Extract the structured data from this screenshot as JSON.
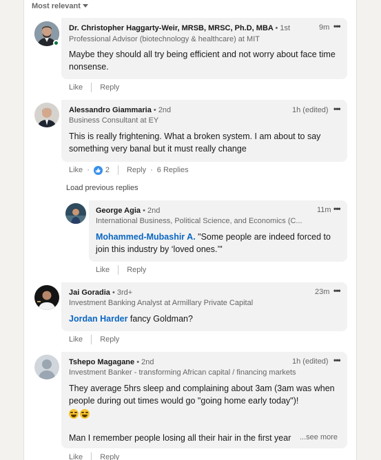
{
  "sort": {
    "label": "Most relevant"
  },
  "comments": [
    {
      "name": "Dr. Christopher Haggarty-Weir, MRSB, MRSC, Ph.D, MBA",
      "degree": "• 1st",
      "headline": "Professional Advisor (biotechnology & healthcare) at MIT",
      "time": "9m",
      "text": "Maybe they should all try being efficient and not worry about face time nonsense.",
      "actions": {
        "like": "Like",
        "reply": "Reply"
      }
    },
    {
      "name": "Alessandro Giammaria",
      "degree": "• 2nd",
      "headline": "Business Consultant at EY",
      "time": "1h (edited)",
      "text": "This is really frightening. What a broken system. I am about to say something very banal but it must really change",
      "actions": {
        "like": "Like",
        "reaction_count": "2",
        "reply": "Reply",
        "replies": "6 Replies"
      },
      "load_previous": "Load previous replies",
      "reply": {
        "name": "George Agia",
        "degree": "• 2nd",
        "headline": "International Business, Political Science, and Economics (C...",
        "time": "11m",
        "mention": "Mohammed-Mubashir A.",
        "text": " \"Some people are indeed forced to join this industry by ‘loved ones.’\"",
        "actions": {
          "like": "Like",
          "reply": "Reply"
        }
      }
    },
    {
      "name": "Jai Goradia",
      "degree": "• 3rd+",
      "headline": "Investment Banking Analyst at Armillary Private Capital",
      "time": "23m",
      "mention": "Jordan Harder",
      "text": " fancy Goldman?",
      "actions": {
        "like": "Like",
        "reply": "Reply"
      }
    },
    {
      "name": "Tshepo Magagane",
      "degree": "• 2nd",
      "headline": "Investment Banker - transforming African capital / financing markets",
      "time": "1h (edited)",
      "text": "They average 5hrs sleep and complaining about 3am (3am was when people during out times would go \"going home early today\")!",
      "text2": "Man I remember people losing all their hair in the first year",
      "see_more": "...see more",
      "actions": {
        "like": "Like",
        "reply": "Reply"
      }
    }
  ]
}
